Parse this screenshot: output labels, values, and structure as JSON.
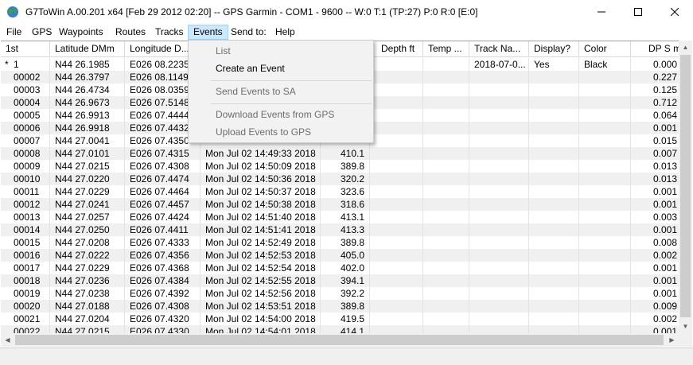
{
  "window": {
    "title": "G7ToWin A.00.201 x64 [Feb 29 2012 02:20] -- GPS Garmin - COM1 - 9600 -- W:0 T:1 (TP:27) P:0 R:0 [E:0]"
  },
  "menubar": {
    "items": [
      {
        "label": "File"
      },
      {
        "label": "GPS"
      },
      {
        "label": "Waypoints"
      },
      {
        "label": "Routes"
      },
      {
        "label": "Tracks"
      },
      {
        "label": "Events",
        "active": true
      },
      {
        "label": "Send to:"
      },
      {
        "label": "Help"
      }
    ]
  },
  "events_menu": {
    "items": [
      {
        "label": "List",
        "enabled": false
      },
      {
        "label": "Create an Event",
        "enabled": true
      },
      {
        "label": "Send Events to SA",
        "enabled": false
      },
      {
        "label": "Download Events from GPS",
        "enabled": false
      },
      {
        "label": "Upload Events to GPS",
        "enabled": false
      }
    ]
  },
  "grid": {
    "columns": [
      "1st",
      "Latitude DMm",
      "Longitude D...",
      "",
      "",
      "Depth  ft",
      "Temp  ...",
      "Track Na...",
      "Display?",
      "Color",
      "DP  S m"
    ],
    "rows": [
      {
        "marker": "*",
        "id": "1",
        "lat": "N44 26.1985",
        "lon": "E026 08.2235",
        "time": "",
        "alt": "",
        "track": "2018-07-0...",
        "display": "Yes",
        "color": "Black",
        "dp": "0.000"
      },
      {
        "marker": "",
        "id": "00002",
        "lat": "N44 26.3797",
        "lon": "E026 08.1149",
        "time": "",
        "alt": "",
        "track": "",
        "display": "",
        "color": "",
        "dp": "0.227"
      },
      {
        "marker": "",
        "id": "00003",
        "lat": "N44 26.4734",
        "lon": "E026 08.0359",
        "time": "",
        "alt": "",
        "track": "",
        "display": "",
        "color": "",
        "dp": "0.125"
      },
      {
        "marker": "",
        "id": "00004",
        "lat": "N44 26.9673",
        "lon": "E026 07.5148",
        "time": "",
        "alt": "",
        "track": "",
        "display": "",
        "color": "",
        "dp": "0.712"
      },
      {
        "marker": "",
        "id": "00005",
        "lat": "N44 26.9913",
        "lon": "E026 07.4444",
        "time": "",
        "alt": "",
        "track": "",
        "display": "",
        "color": "",
        "dp": "0.064"
      },
      {
        "marker": "",
        "id": "00006",
        "lat": "N44 26.9918",
        "lon": "E026 07.4432",
        "time": "",
        "alt": "",
        "track": "",
        "display": "",
        "color": "",
        "dp": "0.001"
      },
      {
        "marker": "",
        "id": "00007",
        "lat": "N44 27.0041",
        "lon": "E026 07.4350",
        "time": "",
        "alt": "",
        "track": "",
        "display": "",
        "color": "",
        "dp": "0.015"
      },
      {
        "marker": "",
        "id": "00008",
        "lat": "N44 27.0101",
        "lon": "E026 07.4315",
        "time": "Mon Jul 02 14:49:33 2018",
        "alt": "410.1",
        "track": "",
        "display": "",
        "color": "",
        "dp": "0.007"
      },
      {
        "marker": "",
        "id": "00009",
        "lat": "N44 27.0215",
        "lon": "E026 07.4308",
        "time": "Mon Jul 02 14:50:09 2018",
        "alt": "389.8",
        "track": "",
        "display": "",
        "color": "",
        "dp": "0.013"
      },
      {
        "marker": "",
        "id": "00010",
        "lat": "N44 27.0220",
        "lon": "E026 07.4474",
        "time": "Mon Jul 02 14:50:36 2018",
        "alt": "320.2",
        "track": "",
        "display": "",
        "color": "",
        "dp": "0.013"
      },
      {
        "marker": "",
        "id": "00011",
        "lat": "N44 27.0229",
        "lon": "E026 07.4464",
        "time": "Mon Jul 02 14:50:37 2018",
        "alt": "323.6",
        "track": "",
        "display": "",
        "color": "",
        "dp": "0.001"
      },
      {
        "marker": "",
        "id": "00012",
        "lat": "N44 27.0241",
        "lon": "E026 07.4457",
        "time": "Mon Jul 02 14:50:38 2018",
        "alt": "318.6",
        "track": "",
        "display": "",
        "color": "",
        "dp": "0.001"
      },
      {
        "marker": "",
        "id": "00013",
        "lat": "N44 27.0257",
        "lon": "E026 07.4424",
        "time": "Mon Jul 02 14:51:40 2018",
        "alt": "413.1",
        "track": "",
        "display": "",
        "color": "",
        "dp": "0.003"
      },
      {
        "marker": "",
        "id": "00014",
        "lat": "N44 27.0250",
        "lon": "E026 07.4411",
        "time": "Mon Jul 02 14:51:41 2018",
        "alt": "413.3",
        "track": "",
        "display": "",
        "color": "",
        "dp": "0.001"
      },
      {
        "marker": "",
        "id": "00015",
        "lat": "N44 27.0208",
        "lon": "E026 07.4333",
        "time": "Mon Jul 02 14:52:49 2018",
        "alt": "389.8",
        "track": "",
        "display": "",
        "color": "",
        "dp": "0.008"
      },
      {
        "marker": "",
        "id": "00016",
        "lat": "N44 27.0222",
        "lon": "E026 07.4356",
        "time": "Mon Jul 02 14:52:53 2018",
        "alt": "405.0",
        "track": "",
        "display": "",
        "color": "",
        "dp": "0.002"
      },
      {
        "marker": "",
        "id": "00017",
        "lat": "N44 27.0229",
        "lon": "E026 07.4368",
        "time": "Mon Jul 02 14:52:54 2018",
        "alt": "402.0",
        "track": "",
        "display": "",
        "color": "",
        "dp": "0.001"
      },
      {
        "marker": "",
        "id": "00018",
        "lat": "N44 27.0236",
        "lon": "E026 07.4384",
        "time": "Mon Jul 02 14:52:55 2018",
        "alt": "394.1",
        "track": "",
        "display": "",
        "color": "",
        "dp": "0.001"
      },
      {
        "marker": "",
        "id": "00019",
        "lat": "N44 27.0238",
        "lon": "E026 07.4392",
        "time": "Mon Jul 02 14:52:56 2018",
        "alt": "392.2",
        "track": "",
        "display": "",
        "color": "",
        "dp": "0.001"
      },
      {
        "marker": "",
        "id": "00020",
        "lat": "N44 27.0188",
        "lon": "E026 07.4308",
        "time": "Mon Jul 02 14:53:51 2018",
        "alt": "389.8",
        "track": "",
        "display": "",
        "color": "",
        "dp": "0.009"
      },
      {
        "marker": "",
        "id": "00021",
        "lat": "N44 27.0204",
        "lon": "E026 07.4320",
        "time": "Mon Jul 02 14:54:00 2018",
        "alt": "419.5",
        "track": "",
        "display": "",
        "color": "",
        "dp": "0.002"
      },
      {
        "marker": "",
        "id": "00022",
        "lat": "N44 27.0215",
        "lon": "E026 07.4330",
        "time": "Mon Jul 02 14:54:01 2018",
        "alt": "414.1",
        "track": "",
        "display": "",
        "color": "",
        "dp": "0.001"
      }
    ]
  },
  "icons": {
    "app": "globe-icon",
    "minimize": "minimize-icon",
    "maximize": "maximize-icon",
    "close": "close-icon"
  },
  "colors": {
    "menu_highlight": "#cce8ff",
    "row_alt": "#f0f0f0",
    "disabled_text": "#6d6d6d"
  }
}
